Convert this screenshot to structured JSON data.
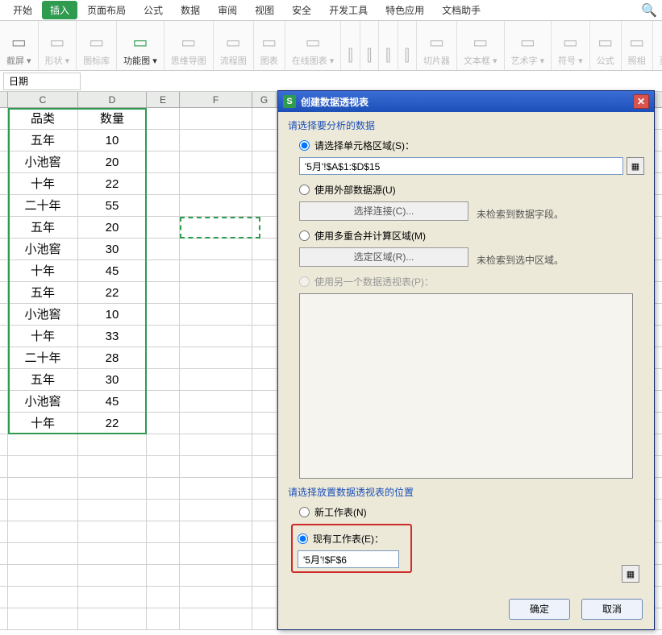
{
  "tabs": [
    "开始",
    "插入",
    "页面布局",
    "公式",
    "数据",
    "审阅",
    "视图",
    "安全",
    "开发工具",
    "特色应用",
    "文档助手"
  ],
  "tabs_active_index": 1,
  "ribbon": [
    {
      "label": "截屏",
      "dd": true,
      "dis": false
    },
    {
      "label": "形状",
      "dd": true,
      "dis": true
    },
    {
      "label": "图标库",
      "dis": true
    },
    {
      "label": "功能图",
      "dd": true,
      "active": true
    },
    {
      "label": "思维导图",
      "dis": true
    },
    {
      "label": "流程图",
      "dis": true
    },
    {
      "label": "图表",
      "dis": true
    },
    {
      "label": "在线图表",
      "dd": true,
      "dis": true
    },
    {
      "label": "",
      "dis": true,
      "ico": "⫿"
    },
    {
      "label": "",
      "dis": true,
      "ico": "⫿"
    },
    {
      "label": "",
      "dis": true,
      "ico": "⫿"
    },
    {
      "label": "",
      "dis": true,
      "ico": "⫿"
    },
    {
      "label": "切片器",
      "dis": true
    },
    {
      "label": "文本框",
      "dd": true,
      "dis": true
    },
    {
      "label": "艺术字",
      "dd": true,
      "dis": true
    },
    {
      "label": "符号",
      "dd": true,
      "dis": true
    },
    {
      "label": "公式",
      "dis": true
    },
    {
      "label": "照相",
      "dis": true
    },
    {
      "label": "页眉",
      "dis": true
    }
  ],
  "name_box": "日期",
  "cols": [
    "C",
    "D",
    "E",
    "F",
    "G"
  ],
  "table": [
    [
      "品类",
      "数量"
    ],
    [
      "五年",
      "10"
    ],
    [
      "小池窖",
      "20"
    ],
    [
      "十年",
      "22"
    ],
    [
      "二十年",
      "55"
    ],
    [
      "五年",
      "20"
    ],
    [
      "小池窖",
      "30"
    ],
    [
      "十年",
      "45"
    ],
    [
      "五年",
      "22"
    ],
    [
      "小池窖",
      "10"
    ],
    [
      "十年",
      "33"
    ],
    [
      "二十年",
      "28"
    ],
    [
      "五年",
      "30"
    ],
    [
      "小池窖",
      "45"
    ],
    [
      "十年",
      "22"
    ]
  ],
  "dialog": {
    "title": "创建数据透视表",
    "sect1": "请选择要分析的数据",
    "opt_range": "请选择单元格区域(S)：",
    "range_value": "'5月'!$A$1:$D$15",
    "opt_ext": "使用外部数据源(U)",
    "btn_conn": "选择连接(C)...",
    "note_conn": "未检索到数据字段。",
    "opt_multi": "使用多重合并计算区域(M)",
    "btn_area": "选定区域(R)...",
    "note_area": "未检索到选中区域。",
    "opt_pivot": "使用另一个数据透视表(P)：",
    "sect2": "请选择放置数据透视表的位置",
    "opt_new": "新工作表(N)",
    "opt_exist": "现有工作表(E)：",
    "exist_value": "'5月'!$F$6",
    "ok": "确定",
    "cancel": "取消"
  }
}
